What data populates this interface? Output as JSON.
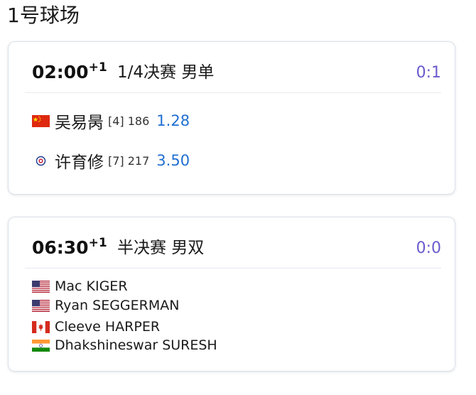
{
  "court": {
    "title": "1号球场"
  },
  "matches": [
    {
      "time": "02:00",
      "day_offset": "+1",
      "round": "1/4决赛 男单",
      "score": "0:1",
      "players": [
        {
          "name": "吴易昺",
          "seed": "[4] 186",
          "odds": "1.28",
          "flag": "china-flag-icon"
        },
        {
          "name": "许育修",
          "seed": "[7] 217",
          "odds": "3.50",
          "flag": "chinese-taipei-flag-icon"
        }
      ]
    },
    {
      "time": "06:30",
      "day_offset": "+1",
      "round": "半决赛 男双",
      "score": "0:0",
      "players": [
        {
          "name": "Mac KIGER",
          "flag": "usa-flag-icon"
        },
        {
          "name": "Ryan SEGGERMAN",
          "flag": "usa-flag-icon"
        },
        {
          "name": "Cleeve HARPER",
          "flag": "canada-flag-icon"
        },
        {
          "name": "Dhakshineswar SURESH",
          "flag": "india-flag-icon"
        }
      ]
    }
  ],
  "colors": {
    "score": "#6a5acd",
    "odds": "#1f6fd1",
    "border": "#d9e0ea"
  }
}
